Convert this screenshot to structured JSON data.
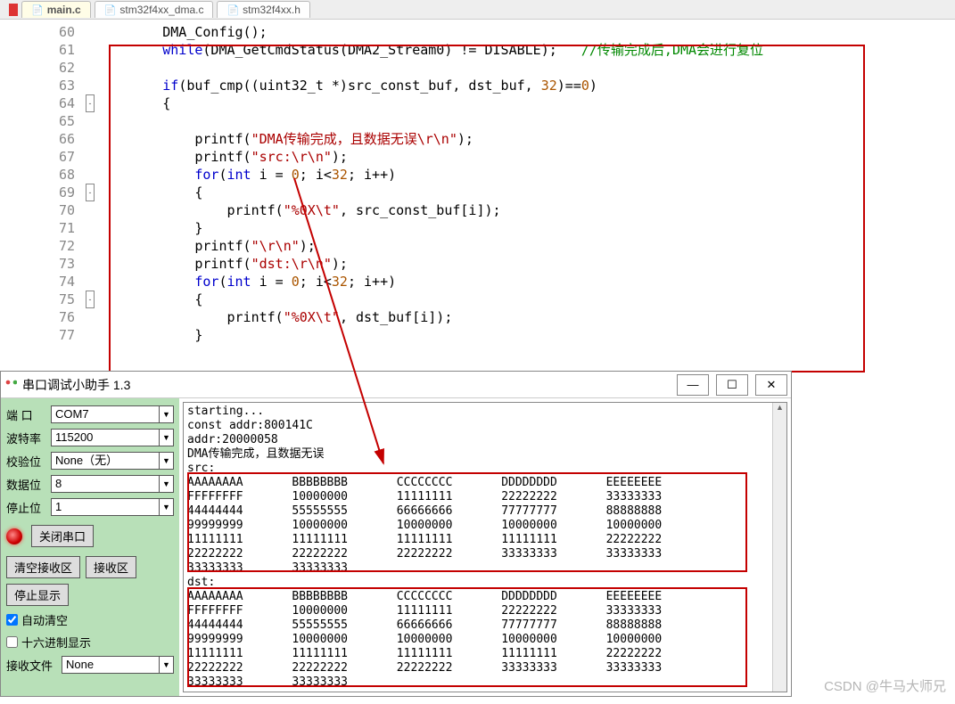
{
  "tabs": [
    {
      "name": "main.c",
      "icon": "📄",
      "active": true
    },
    {
      "name": "stm32f4xx_dma.c",
      "icon": "📄",
      "active": false
    },
    {
      "name": "stm32f4xx.h",
      "icon": "📄",
      "active": false
    }
  ],
  "code_start_line": 60,
  "code_lines": [
    {
      "n": 60,
      "fold": "",
      "html": "        DMA_Config();"
    },
    {
      "n": 61,
      "fold": "",
      "html": "        <span class='kw'>while</span>(DMA_GetCmdStatus(DMA2_Stream0) != DISABLE);   <span class='cmt'>//传输完成后,DMA会进行复位</span>"
    },
    {
      "n": 62,
      "fold": "",
      "html": ""
    },
    {
      "n": 63,
      "fold": "",
      "html": "        <span class='kw'>if</span>(buf_cmp((uint32_t *)src_const_buf, dst_buf, <span class='num'>32</span>)==<span class='num'>0</span>)"
    },
    {
      "n": 64,
      "fold": "-",
      "html": "        {"
    },
    {
      "n": 65,
      "fold": "",
      "html": ""
    },
    {
      "n": 66,
      "fold": "",
      "html": "            printf(<span class='str'>\"DMA传输完成，且数据无误\\r\\n\"</span>);"
    },
    {
      "n": 67,
      "fold": "",
      "html": "            printf(<span class='str'>\"src:\\r\\n\"</span>);"
    },
    {
      "n": 68,
      "fold": "",
      "html": "            <span class='kw'>for</span>(<span class='kw'>int</span> i = <span class='num'>0</span>; i&lt;<span class='num'>32</span>; i++)"
    },
    {
      "n": 69,
      "fold": "-",
      "html": "            {"
    },
    {
      "n": 70,
      "fold": "",
      "html": "                printf(<span class='str'>\"%0X\\t\"</span>, src_const_buf[i]);"
    },
    {
      "n": 71,
      "fold": "",
      "html": "            }"
    },
    {
      "n": 72,
      "fold": "",
      "html": "            printf(<span class='str'>\"\\r\\n\"</span>);"
    },
    {
      "n": 73,
      "fold": "",
      "html": "            printf(<span class='str'>\"dst:\\r\\n\"</span>);"
    },
    {
      "n": 74,
      "fold": "",
      "html": "            <span class='kw'>for</span>(<span class='kw'>int</span> i = <span class='num'>0</span>; i&lt;<span class='num'>32</span>; i++)"
    },
    {
      "n": 75,
      "fold": "-",
      "html": "            {"
    },
    {
      "n": 76,
      "fold": "",
      "html": "                printf(<span class='str'>\"%0X\\t\"</span>, dst_buf[i]);"
    },
    {
      "n": 77,
      "fold": "",
      "html": "            }"
    }
  ],
  "serial": {
    "title": "串口调试小助手 1.3",
    "fields": {
      "port_label": "端  口",
      "port": "COM7",
      "baud_label": "波特率",
      "baud": "115200",
      "parity_label": "校验位",
      "parity": "None（无）",
      "data_label": "数据位",
      "data": "8",
      "stop_label": "停止位",
      "stop": "1"
    },
    "close_btn": "关闭串口",
    "clear_rx_btn": "清空接收区",
    "rx_area_btn": "接收区",
    "stop_disp_btn": "停止显示",
    "auto_clear": "自动清空",
    "hex_disp": "十六进制显示",
    "rx_file_label": "接收文件",
    "rx_file": "None",
    "output_header": "starting...\nconst addr:800141C\naddr:20000058\nDMA传输完成，且数据无误\nsrc:",
    "src_rows": [
      [
        "AAAAAAAA",
        "BBBBBBBB",
        "CCCCCCCC",
        "DDDDDDDD",
        "EEEEEEEE"
      ],
      [
        "FFFFFFFF",
        "10000000",
        "11111111",
        "22222222",
        "33333333"
      ],
      [
        "44444444",
        "55555555",
        "66666666",
        "77777777",
        "88888888"
      ],
      [
        "99999999",
        "10000000",
        "10000000",
        "10000000",
        "10000000"
      ],
      [
        "11111111",
        "11111111",
        "11111111",
        "11111111",
        "22222222"
      ],
      [
        "22222222",
        "22222222",
        "22222222",
        "33333333",
        "33333333"
      ],
      [
        "33333333",
        "33333333"
      ]
    ],
    "dst_label": "dst:",
    "dst_rows": [
      [
        "AAAAAAAA",
        "BBBBBBBB",
        "CCCCCCCC",
        "DDDDDDDD",
        "EEEEEEEE"
      ],
      [
        "FFFFFFFF",
        "10000000",
        "11111111",
        "22222222",
        "33333333"
      ],
      [
        "44444444",
        "55555555",
        "66666666",
        "77777777",
        "88888888"
      ],
      [
        "99999999",
        "10000000",
        "10000000",
        "10000000",
        "10000000"
      ],
      [
        "11111111",
        "11111111",
        "11111111",
        "11111111",
        "22222222"
      ],
      [
        "22222222",
        "22222222",
        "22222222",
        "33333333",
        "33333333"
      ],
      [
        "33333333",
        "33333333"
      ]
    ]
  },
  "watermark": "CSDN @牛马大师兄"
}
